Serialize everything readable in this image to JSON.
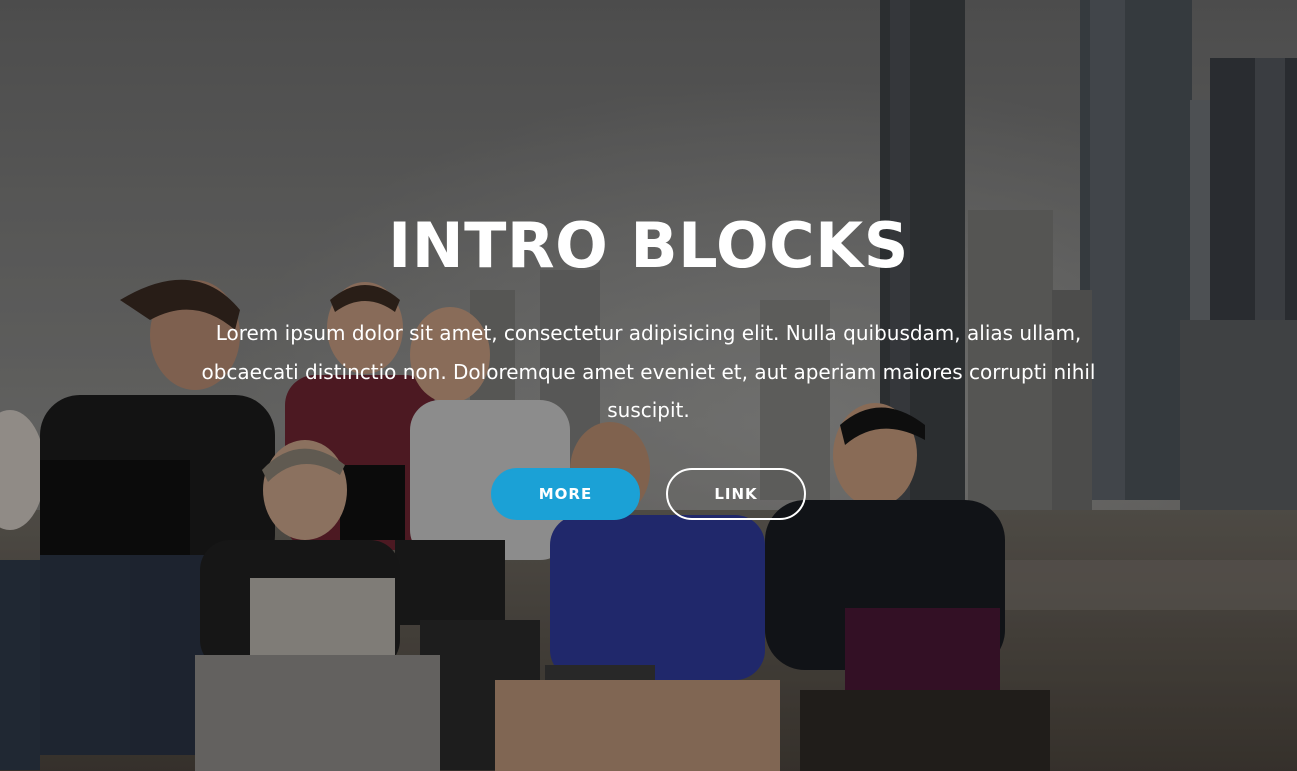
{
  "hero": {
    "title": "INTRO BLOCKS",
    "description": "Lorem ipsum dolor sit amet, consectetur adipisicing elit. Nulla quibusdam, alias ullam, obcaecati distinctio non. Doloremque amet eveniet et, aut aperiam maiores corrupti nihil suscipit.",
    "primary_button": "MORE",
    "secondary_button": "LINK",
    "background_image": "people-with-laptops-on-beach-with-city-skyline",
    "colors": {
      "primary_button": "#1ba1d6",
      "overlay": "#000000",
      "text": "#ffffff"
    }
  }
}
